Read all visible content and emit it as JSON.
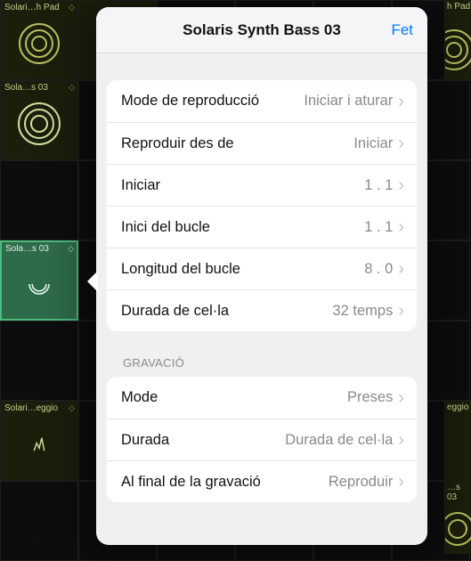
{
  "popover": {
    "title": "Solaris Synth Bass 03",
    "done": "Fet",
    "settings": [
      {
        "label": "Mode de reproducció",
        "value": "Iniciar i aturar"
      },
      {
        "label": "Reproduir des de",
        "value": "Iniciar"
      },
      {
        "label": "Iniciar",
        "value": "1 . 1"
      },
      {
        "label": "Inici del bucle",
        "value": "1 . 1"
      },
      {
        "label": "Longitud del bucle",
        "value": "8 . 0"
      },
      {
        "label": "Durada de cel·la",
        "value": "32 temps"
      }
    ],
    "recording_header": "GRAVACIÓ",
    "recording": [
      {
        "label": "Mode",
        "value": "Preses"
      },
      {
        "label": "Durada",
        "value": "Durada de cel·la"
      },
      {
        "label": "Al final de la gravació",
        "value": "Reproduir"
      }
    ]
  },
  "cells": {
    "a0": "Solari…h Pad",
    "a3": "Sola…s 03",
    "a5": "Solari…eggio",
    "edge_top": "h Pad",
    "edge_mid": "eggio",
    "edge_bot": "…s 03"
  }
}
